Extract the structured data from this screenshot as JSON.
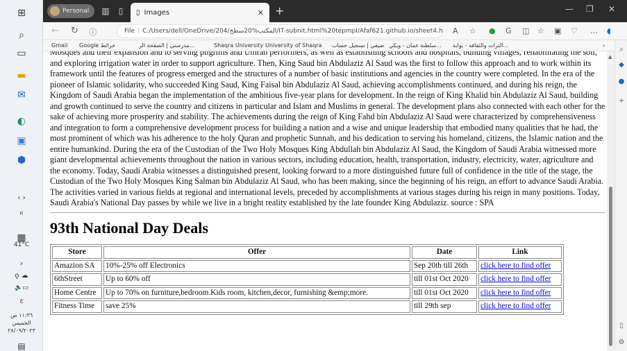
{
  "taskbar": {
    "weather_temp": "41°C",
    "time": "١١:٣٦ ص",
    "day": "الخميس",
    "date": "٢٨/٠٩/٢٠٢٣"
  },
  "browser": {
    "profile_label": "Personal",
    "tab_title": "Images",
    "url": "C:/Users/dell/OneDrive/204/المكتب%20سطح/IT-subnit.html%20tepmpl/Afaf621.github.io/sheet4.html",
    "url_prefix": "File",
    "bookmarks": [
      "Gmail",
      "Google خرائط",
      "مدرستي | الصفحة الر...",
      "Shaqra University",
      "University of Shaqra",
      "صيفي | تسجيل حساب",
      "سلطنة عمان - ويكي...",
      "التراث والثقافة - بوابة..."
    ]
  },
  "page": {
    "paragraph": "Mosques and their expansion and to serving pilgrims and Umrah performers, as well as establishing schools and hospitals, building villages, rehabilitating the soil, and exploring irrigation water in order to support agriculture. Then, King Saud bin Abdulaziz Al Saud was the first to follow this approach and to work within its framework until the features of progress emerged and the structures of a number of basic institutions and agencies in the country were completed. In the era of the pioneer of Islamic solidarity, who succeeded King Saud, King Faisal bin Abdulaziz Al Saud, achieving accomplishments continued, and during his reign, the Kingdom of Saudi Arabia began the implementation of the ambitious five-year plans for development. In the reign of King Khalid bin Abdulaziz Al Saud, building and growth continued to serve the country and citizens in particular and Islam and Muslims in general. The development plans also connected with each other for the sake of achieving more prosperity and stability. The achievements during the reign of King Fahd bin Abdulaziz Al Saud were characterized by comprehensiveness and integration to form a comprehensive development process for building a nation and a wise and unique leadership that embodied many qualities that he had, the most prominent of which was his adherence to the holy Quran and prophetic Sunnah, and his dedication to serving his homeland, citizens, the Islamic nation and the entire humankind. During the era of the Custodian of the Two Holy Mosques King Abdullah bin Abdulaziz Al Saud, the Kingdom of Saudi Arabia witnessed more giant developmental achievements throughout the nation in various sectors, including education, health, transportation, industry, electricity, water, agriculture and the economy. Today, Saudi Arabia witnesses a distinguished present, looking forward to a more distinguished future full of confidence in the title of the stage, the Custodian of the Two Holy Mosques King Salman bin Abdulaziz Al Saud, who has been making, since the beginning of his reign, an effort to advance Saudi Arabia. The activities varied in various fields at regional and international levels, preceded by accomplishments at various stages during his reign in many positions. Today, Saudi Arabia's National Day passes by while we live in a bright reality established by the late founder King Abdulaziz. source : SPA",
    "heading": "93th National Day Deals",
    "table": {
      "headers": [
        "Store",
        "Offer",
        "Date",
        "Link"
      ],
      "rows": [
        [
          "Amazion SA",
          "10%-25% off Electronics",
          "Sep 20th till 26th",
          "click here to find offer"
        ],
        [
          "6thStreet",
          "Up to 60% off",
          "till 01st Oct 2020",
          "click here to find offer"
        ],
        [
          "Home Centre",
          "Up to 70% on furniture,bedroom.Kids room, kitchen,decor, furnishing &emp;more.",
          "till 01st Oct 2020",
          "click here to find offer"
        ],
        [
          "Fitness Time",
          "save 25%",
          "till 29th sep",
          "click here to find offer"
        ]
      ]
    }
  }
}
